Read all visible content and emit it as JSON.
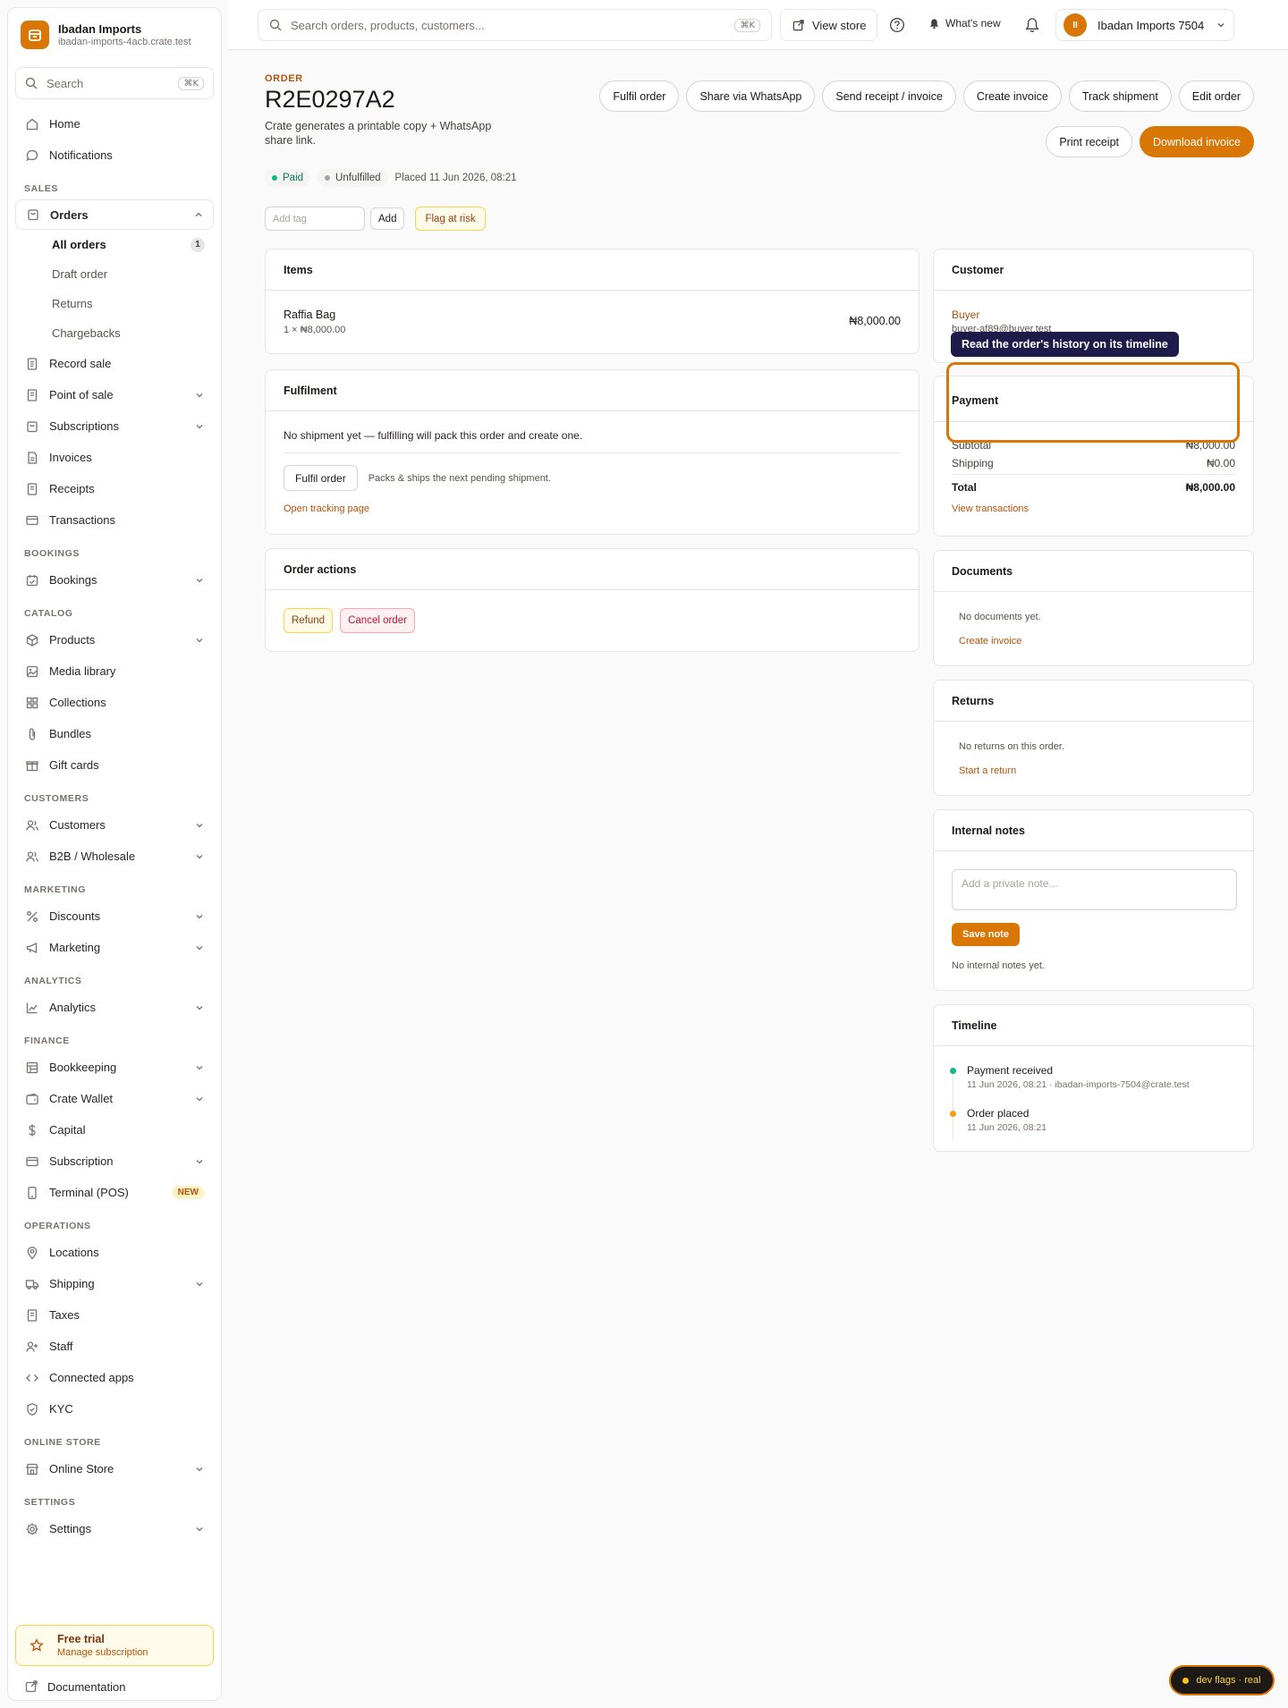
{
  "brand": {
    "name": "Ibadan Imports",
    "domain": "ibadan-imports-4acb.crate.test"
  },
  "sidebar_search": {
    "placeholder": "Search",
    "shortcut": "⌘K"
  },
  "nav": {
    "home": "Home",
    "notifications": "Notifications",
    "sales_label": "SALES",
    "orders": "Orders",
    "orders_sub": [
      {
        "label": "All orders",
        "count": "1"
      },
      {
        "label": "Draft order"
      },
      {
        "label": "Returns"
      },
      {
        "label": "Chargebacks"
      }
    ],
    "record_sale": "Record sale",
    "point_of_sale": "Point of sale",
    "subscriptions": "Subscriptions",
    "invoices": "Invoices",
    "receipts": "Receipts",
    "transactions": "Transactions",
    "bookings_label": "BOOKINGS",
    "bookings": "Bookings",
    "catalog_label": "CATALOG",
    "products": "Products",
    "media_library": "Media library",
    "collections": "Collections",
    "bundles": "Bundles",
    "gift_cards": "Gift cards",
    "customers_label": "CUSTOMERS",
    "customers": "Customers",
    "b2b": "B2B / Wholesale",
    "marketing_label": "MARKETING",
    "discounts": "Discounts",
    "marketing": "Marketing",
    "analytics_label": "ANALYTICS",
    "analytics": "Analytics",
    "finance_label": "FINANCE",
    "bookkeeping": "Bookkeeping",
    "crate_wallet": "Crate Wallet",
    "capital": "Capital",
    "subscription": "Subscription",
    "terminal": "Terminal (POS)",
    "terminal_badge": "NEW",
    "operations_label": "OPERATIONS",
    "locations": "Locations",
    "shipping": "Shipping",
    "taxes": "Taxes",
    "staff": "Staff",
    "connected_apps": "Connected apps",
    "kyc": "KYC",
    "online_store_label": "ONLINE STORE",
    "online_store": "Online Store",
    "settings_label": "SETTINGS",
    "settings": "Settings"
  },
  "trial": {
    "title": "Free trial",
    "subtitle": "Manage subscription"
  },
  "documentation": "Documentation",
  "topbar": {
    "search_placeholder": "Search orders, products, customers...",
    "search_shortcut": "⌘K",
    "view_store": "View store",
    "whats_new": "What's new",
    "account_name": "Ibadan Imports 7504",
    "account_initials": "II"
  },
  "order": {
    "eyebrow": "ORDER",
    "id": "R2E0297A2",
    "subtitle": "Crate generates a printable copy + WhatsApp share link.",
    "actions": [
      "Fulfil order",
      "Share via WhatsApp",
      "Send receipt / invoice",
      "Create invoice",
      "Track shipment",
      "Edit order"
    ],
    "print_receipt": "Print receipt",
    "download_invoice": "Download invoice",
    "status_paid": "Paid",
    "status_unfulfilled": "Unfulfilled",
    "placed": "Placed 11 Jun 2026, 08:21",
    "tag_placeholder": "Add tag",
    "add": "Add",
    "flag": "Flag at risk"
  },
  "items": {
    "title": "Items",
    "name": "Raffia Bag",
    "qty_price": "1 × ₦8,000.00",
    "total": "₦8,000.00"
  },
  "fulfilment": {
    "title": "Fulfilment",
    "message": "No shipment yet — fulfilling will pack this order and create one.",
    "button": "Fulfil order",
    "hint": "Packs & ships the next pending shipment.",
    "tracking_link": "Open tracking page"
  },
  "order_actions": {
    "title": "Order actions",
    "refund": "Refund",
    "cancel": "Cancel order"
  },
  "customer": {
    "title": "Customer",
    "name": "Buyer",
    "email": "buyer-af89@buyer.test"
  },
  "tooltip": "Read the order's history on its timeline",
  "payment": {
    "title": "Payment",
    "subtotal_label": "Subtotal",
    "subtotal": "₦8,000.00",
    "shipping_label": "Shipping",
    "shipping": "₦0.00",
    "total_label": "Total",
    "total": "₦8,000.00",
    "view_transactions": "View transactions"
  },
  "documents": {
    "title": "Documents",
    "empty": "No documents yet.",
    "link": "Create invoice"
  },
  "returns": {
    "title": "Returns",
    "empty": "No returns on this order.",
    "link": "Start a return"
  },
  "notes": {
    "title": "Internal notes",
    "placeholder": "Add a private note...",
    "save": "Save note",
    "empty": "No internal notes yet."
  },
  "timeline": {
    "title": "Timeline",
    "events": [
      {
        "title": "Payment received",
        "meta": "11 Jun 2026, 08:21 · ibadan-imports-7504@crate.test",
        "color": "#10b981"
      },
      {
        "title": "Order placed",
        "meta": "11 Jun 2026, 08:21",
        "color": "#f59e0b"
      }
    ]
  },
  "devflags": "dev flags · real",
  "colors": {
    "accent": "#d97706",
    "accent_text": "#b45309",
    "paid": "#10b981",
    "unfulfilled": "#a8a29e"
  }
}
